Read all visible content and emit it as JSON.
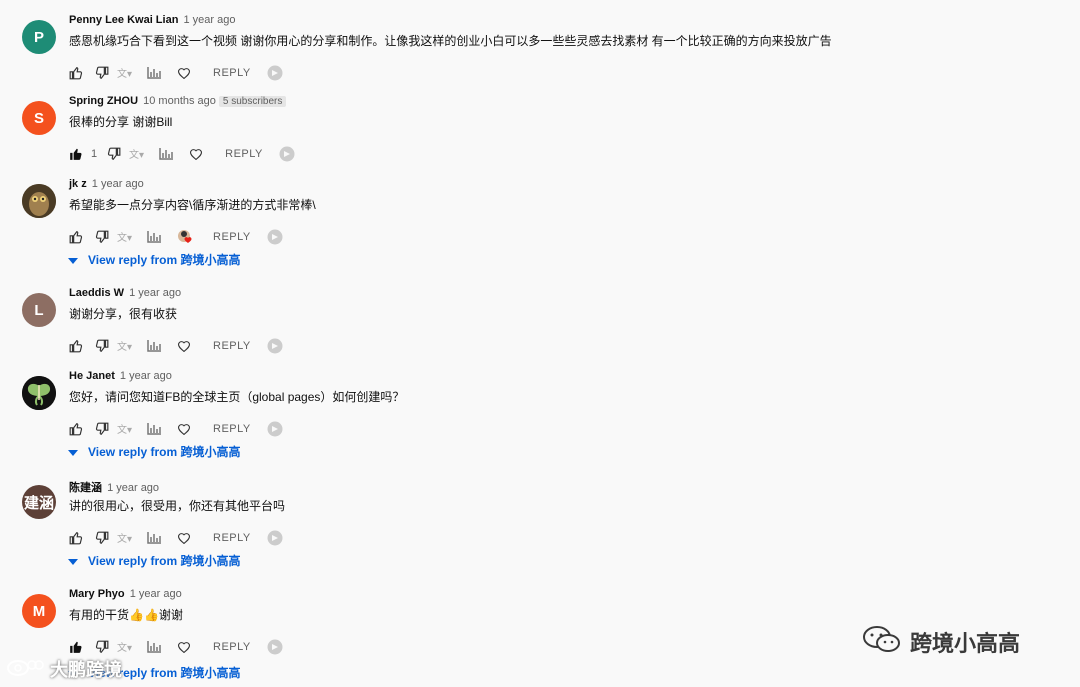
{
  "comments": [
    {
      "author": "Penny Lee Kwai Lian",
      "time": "1 year ago",
      "text": "感恩机缘巧合下看到这一个视频 谢谢你用心的分享和制作。让像我这样的创业小白可以多一些些灵感去找素材 有一个比较正确的方向来投放广告",
      "avatar_letter": "P",
      "avatar_color": "#1e8c76",
      "reply_label": "REPLY"
    },
    {
      "author": "Spring ZHOU",
      "time": "10 months ago",
      "subscribers": "5 subscribers",
      "text": "很棒的分享 谢谢Bill",
      "avatar_letter": "S",
      "avatar_color": "#f4511e",
      "likes": "1",
      "reply_label": "REPLY"
    },
    {
      "author": "jk z",
      "time": "1 year ago",
      "text": "希望能多一点分享内容\\循序渐进的方式非常棒\\",
      "reply_label": "REPLY",
      "view_reply": "View reply from 跨境小高高"
    },
    {
      "author": "Laeddis W",
      "time": "1 year ago",
      "text": "谢谢分享，很有收获",
      "avatar_letter": "L",
      "avatar_color": "#8d6e63",
      "reply_label": "REPLY"
    },
    {
      "author": "He Janet",
      "time": "1 year ago",
      "text": "您好，请问您知道FB的全球主页（global pages）如何创建吗？",
      "reply_label": "REPLY",
      "view_reply": "View reply from 跨境小高高"
    },
    {
      "author": "陈建涵",
      "time": "1 year ago",
      "text": "讲的很用心，很受用，你还有其他平台吗",
      "avatar_letter": "建涵",
      "avatar_color": "#5d4037",
      "reply_label": "REPLY",
      "view_reply": "View reply from 跨境小高高"
    },
    {
      "author": "Mary Phyo",
      "time": "1 year ago",
      "text": "有用的干货👍👍谢谢",
      "avatar_letter": "M",
      "avatar_color": "#f4511e",
      "reply_label": "REPLY",
      "view_reply": "View reply from 跨境小高高"
    }
  ],
  "watermarks": {
    "right": "跨境小高高",
    "left": "大鹏跨境"
  }
}
